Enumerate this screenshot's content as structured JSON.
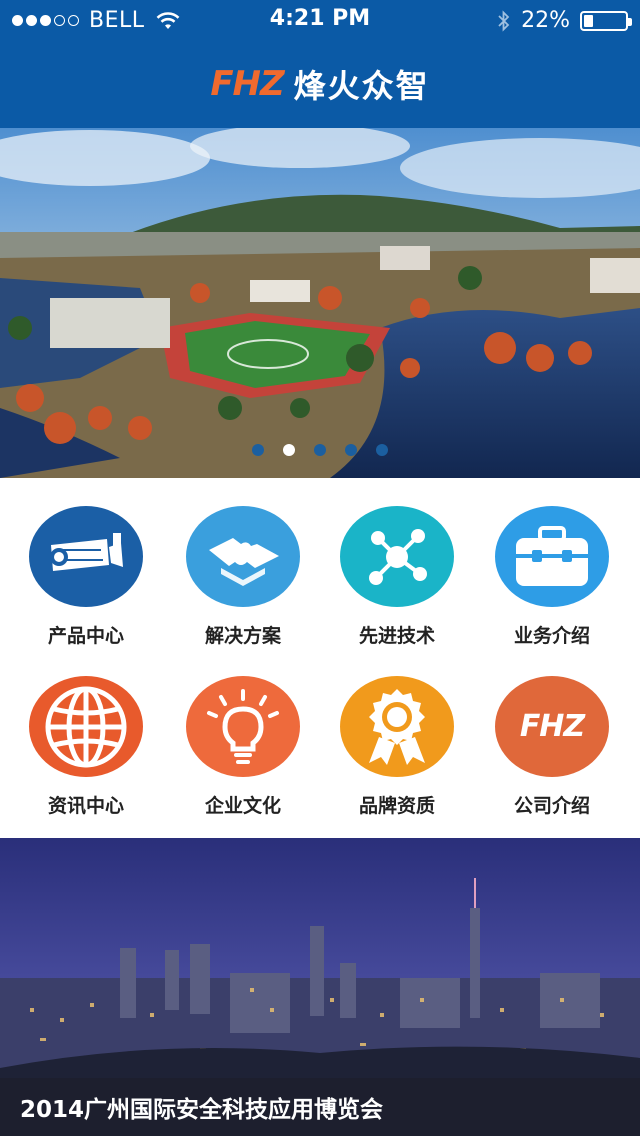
{
  "status_bar": {
    "carrier": "BELL",
    "signal_bars_filled": 3,
    "signal_bars_total": 5,
    "time": "4:21 PM",
    "battery_percent": "22%",
    "battery_level": 0.22
  },
  "navbar": {
    "logo_mark": "FHZ",
    "brand_name": "烽火众智"
  },
  "banner": {
    "pages": 5,
    "active_page": 1
  },
  "categories": [
    {
      "label": "产品中心",
      "icon": "camera-icon",
      "color": "#1b5fa6"
    },
    {
      "label": "解决方案",
      "icon": "puzzle-icon",
      "color": "#3a9fdd"
    },
    {
      "label": "先进技术",
      "icon": "network-icon",
      "color": "#1ab4c8"
    },
    {
      "label": "业务介绍",
      "icon": "toolbox-icon",
      "color": "#2e9de6"
    },
    {
      "label": "资讯中心",
      "icon": "globe-icon",
      "color": "#e85a2c"
    },
    {
      "label": "企业文化",
      "icon": "lightbulb-icon",
      "color": "#ee6a3c"
    },
    {
      "label": "品牌资质",
      "icon": "award-icon",
      "color": "#f19a1c"
    },
    {
      "label": "公司介绍",
      "icon": "fhz-logo-icon",
      "color": "#e0683a",
      "mark": "FHZ"
    }
  ],
  "news_banner": {
    "caption": "2014广州国际安全科技应用博览会"
  }
}
